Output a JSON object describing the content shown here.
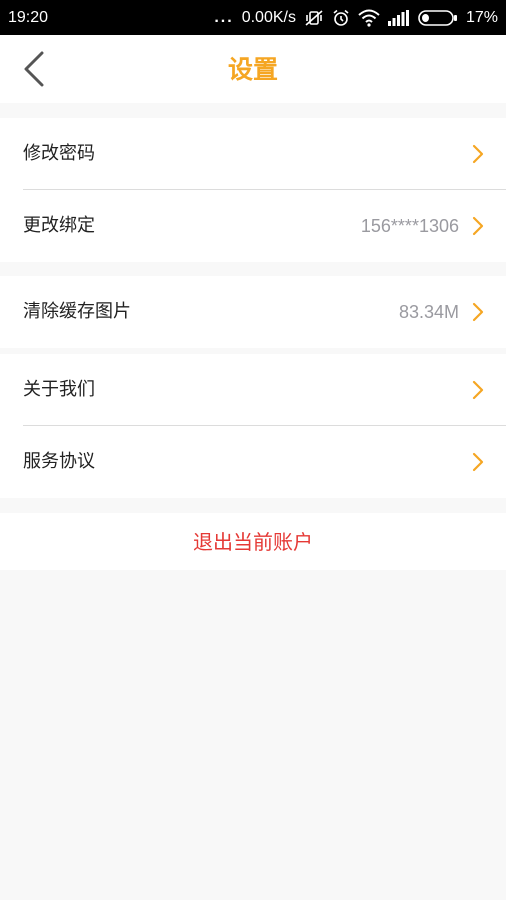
{
  "status_bar": {
    "time": "19:20",
    "dots": "...",
    "net_speed": "0.00K/s",
    "battery": "17%"
  },
  "header": {
    "title": "设置"
  },
  "settings": {
    "change_password": {
      "label": "修改密码"
    },
    "change_binding": {
      "label": "更改绑定",
      "value": "156****1306"
    },
    "clear_cache": {
      "label": "清除缓存图片",
      "value": "83.34M"
    },
    "about_us": {
      "label": "关于我们"
    },
    "service_agreement": {
      "label": "服务协议"
    }
  },
  "logout": {
    "label": "退出当前账户"
  },
  "colors": {
    "accent": "#f5a623",
    "danger": "#e53935",
    "value_text": "#9a9aa0",
    "page_bg": "#f8f8f8"
  },
  "icons": {
    "back": "chevron-left-icon",
    "row_arrow": "chevron-right-icon",
    "mute": "vibrate-off-icon",
    "alarm": "alarm-icon",
    "wifi": "wifi-icon",
    "signal": "signal-icon",
    "battery": "battery-icon"
  }
}
